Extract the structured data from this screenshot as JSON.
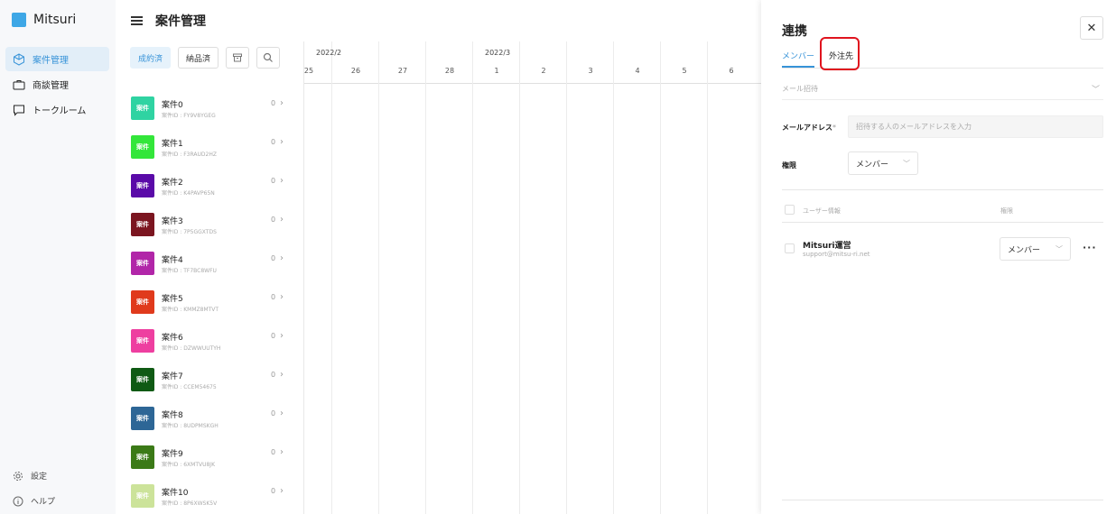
{
  "app": {
    "name": "Mitsuri",
    "brand_color": "#3ea7e6"
  },
  "sidebar": {
    "items": [
      {
        "label": "案件管理",
        "icon": "cube-icon",
        "active": true
      },
      {
        "label": "商談管理",
        "icon": "briefcase-icon",
        "active": false
      },
      {
        "label": "トークルーム",
        "icon": "chat-icon",
        "active": false
      }
    ],
    "settings_label": "設定",
    "help_label": "ヘルプ"
  },
  "header": {
    "title": "案件管理"
  },
  "filters": {
    "contracted": "成約済",
    "delivered": "納品済"
  },
  "cases": [
    {
      "badge": "案件",
      "title": "案件0",
      "sub": "案件ID : FY9V8YGEG",
      "count": "0",
      "color": "#2fd3a2"
    },
    {
      "badge": "案件",
      "title": "案件1",
      "sub": "案件ID : F3RAUD2HZ",
      "count": "0",
      "color": "#33e63a"
    },
    {
      "badge": "案件",
      "title": "案件2",
      "sub": "案件ID : K4PAVP65N",
      "count": "0",
      "color": "#5a0aa8"
    },
    {
      "badge": "案件",
      "title": "案件3",
      "sub": "案件ID : 7P5GGXTDS",
      "count": "0",
      "color": "#7b1520"
    },
    {
      "badge": "案件",
      "title": "案件4",
      "sub": "案件ID : TF7BC8WFU",
      "count": "0",
      "color": "#b126a8"
    },
    {
      "badge": "案件",
      "title": "案件5",
      "sub": "案件ID : KMMZ8MTVT",
      "count": "0",
      "color": "#e03a1c"
    },
    {
      "badge": "案件",
      "title": "案件6",
      "sub": "案件ID : DZWWUUTYH",
      "count": "0",
      "color": "#ee3fa0"
    },
    {
      "badge": "案件",
      "title": "案件7",
      "sub": "案件ID : CCEM54675",
      "count": "0",
      "color": "#0f5a14"
    },
    {
      "badge": "案件",
      "title": "案件8",
      "sub": "案件ID : 8UDPMSKGH",
      "count": "0",
      "color": "#2d6696"
    },
    {
      "badge": "案件",
      "title": "案件9",
      "sub": "案件ID : 6XMTVU8JK",
      "count": "0",
      "color": "#3b7a17"
    },
    {
      "badge": "案件",
      "title": "案件10",
      "sub": "案件ID : 8P6XWSK5V",
      "count": "0",
      "color": "#cce39a"
    }
  ],
  "gantt": {
    "months": [
      {
        "label": "2022/2"
      },
      {
        "label": "2022/3"
      }
    ],
    "days": [
      "25",
      "26",
      "27",
      "28",
      "1",
      "2",
      "3",
      "4",
      "5",
      "6"
    ]
  },
  "panel": {
    "title": "連携",
    "tabs": [
      "メンバー",
      "外注先"
    ],
    "invite_label": "メール招待",
    "email_label": "メールアドレス",
    "email_required": "*",
    "email_placeholder": "招待する人のメールアドレスを入力",
    "role_label": "権限",
    "role_value": "メンバー",
    "table": {
      "col_user": "ユーザー情報",
      "col_role": "権限"
    },
    "users": [
      {
        "name": "Mitsuri運営",
        "email": "support@mitsu-ri.net",
        "role": "メンバー"
      }
    ],
    "close_symbol": "✕",
    "more_symbol": "···",
    "highlight_color": "#e0141e"
  }
}
